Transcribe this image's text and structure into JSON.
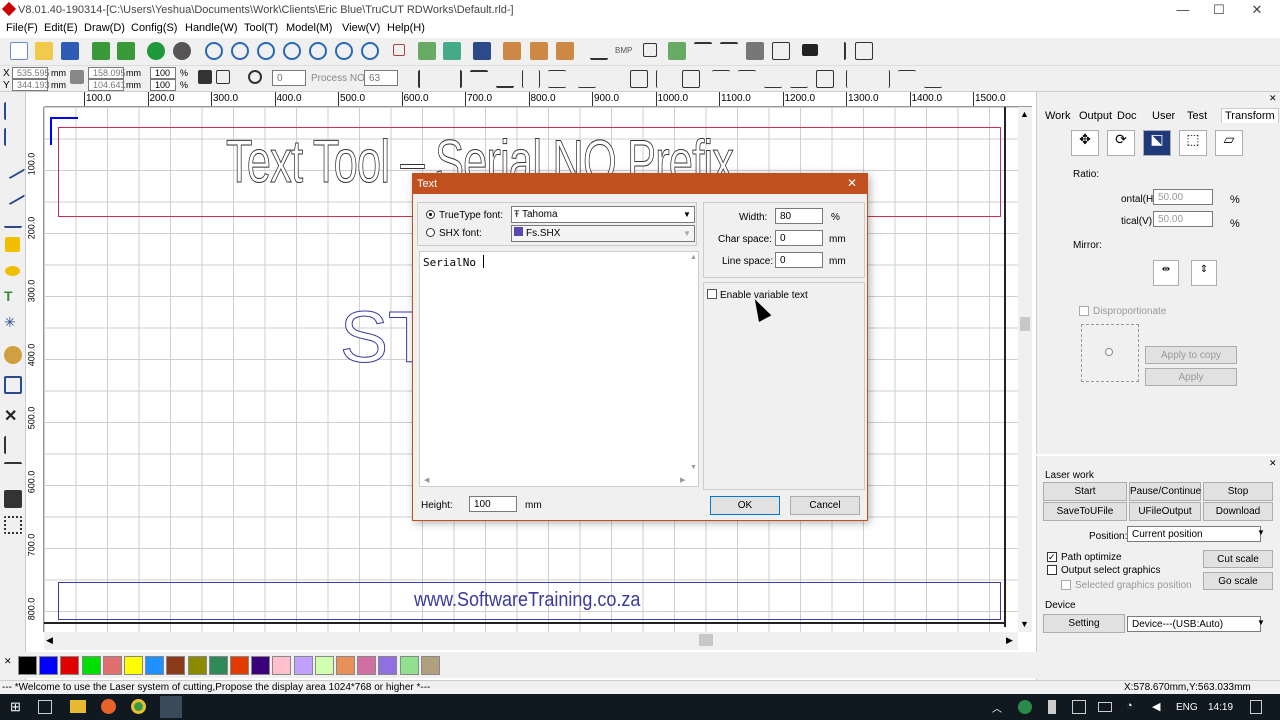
{
  "window": {
    "title": "V8.01.40-190314-[C:\\Users\\Yeshua\\Documents\\Work\\Clients\\Eric Blue\\TruCUT RDWorks\\Default.rld-]",
    "min": "—",
    "max": "☐",
    "close": "✕"
  },
  "menu": [
    "File(F)",
    "Edit(E)",
    "Draw(D)",
    "Config(S)",
    "Handle(W)",
    "Tool(T)",
    "Model(M)",
    "View(V)",
    "Help(H)"
  ],
  "coords": {
    "x_label": "X",
    "x_val": "535.595",
    "x_unit": "mm",
    "y_label": "Y",
    "y_val": "344.193",
    "y_unit": "mm",
    "w_val": "158.095",
    "w_unit": "mm",
    "h_val": "104.641",
    "h_unit": "mm",
    "px_val": "100",
    "px_unit": "%",
    "py_val": "100",
    "py_unit": "%",
    "rot_val": "0",
    "process_label": "Process NO:",
    "process_val": "63"
  },
  "ruler_h": [
    "100.0",
    "200.0",
    "300.0",
    "400.0",
    "500.0",
    "600.0",
    "700.0",
    "800.0",
    "900.0",
    "1000.0",
    "1100.0",
    "1200.0",
    "1300.0",
    "1400.0",
    "1500.0"
  ],
  "ruler_v": [
    "100.0",
    "200.0",
    "300.0",
    "400.0",
    "500.0",
    "600.0",
    "700.0",
    "800.0"
  ],
  "canvas": {
    "header_text": "Text Tool – Serial NO Prefix",
    "st_text": "ST",
    "footer_text": "www.SoftwareTraining.co.za"
  },
  "dialog": {
    "title": "Text",
    "truetype_label": "TrueType font:",
    "truetype_value": "Tahoma",
    "shx_label": "SHX font:",
    "shx_value": "Fs.SHX",
    "text_value": "SerialNo",
    "width_label": "Width:",
    "width_val": "80",
    "width_unit": "%",
    "char_label": "Char space:",
    "char_val": "0",
    "char_unit": "mm",
    "line_label": "Line space:",
    "line_val": "0",
    "line_unit": "mm",
    "variable_label": "Enable variable text",
    "height_label": "Height:",
    "height_val": "100",
    "height_unit": "mm",
    "ok": "OK",
    "cancel": "Cancel"
  },
  "rpanel": {
    "tabs": [
      "Work",
      "Output",
      "Doc",
      "User",
      "Test",
      "Transform"
    ],
    "ratio_label": "Ratio:",
    "hz_label": "ontal(H)",
    "hz_val": "50.00",
    "hz_unit": "%",
    "vt_label": "tical(V)",
    "vt_val": "50.00",
    "vt_unit": "%",
    "mirror_label": "Mirror:",
    "disp_label": "Disproportionate",
    "apply_copy": "Apply to copy",
    "apply": "Apply"
  },
  "laser": {
    "title": "Laser work",
    "start": "Start",
    "pause": "Pause/Continue",
    "stop": "Stop",
    "save_ufile": "SaveToUFile",
    "ufile_output": "UFileOutput",
    "download": "Download",
    "position_label": "Position:",
    "position_val": "Current position",
    "path_opt": "Path optimize",
    "output_sel": "Output select graphics",
    "sel_pos": "Selected graphics position",
    "cut_scale": "Cut scale",
    "go_scale": "Go scale",
    "device_title": "Device",
    "setting": "Setting",
    "device_val": "Device---(USB:Auto)"
  },
  "palette": [
    "#000000",
    "#0000ff",
    "#e00000",
    "#00e000",
    "#e07070",
    "#ffff00",
    "#1e90ff",
    "#8b3a1a",
    "#8b8b00",
    "#2e8b57",
    "#e03c00",
    "#3a007a",
    "#ffc0cb",
    "#c0a0ff",
    "#d0ffb0",
    "#e8905a",
    "#d070a0",
    "#9070e0",
    "#90e090",
    "#b0a080"
  ],
  "status": {
    "message": "--- *Welcome to use the Laser system of cutting,Propose the display area 1024*768 or higher *---",
    "coords": "X:578.670mm,Y:563.033mm"
  },
  "taskbar": {
    "lang": "ENG",
    "time": "14:19"
  }
}
